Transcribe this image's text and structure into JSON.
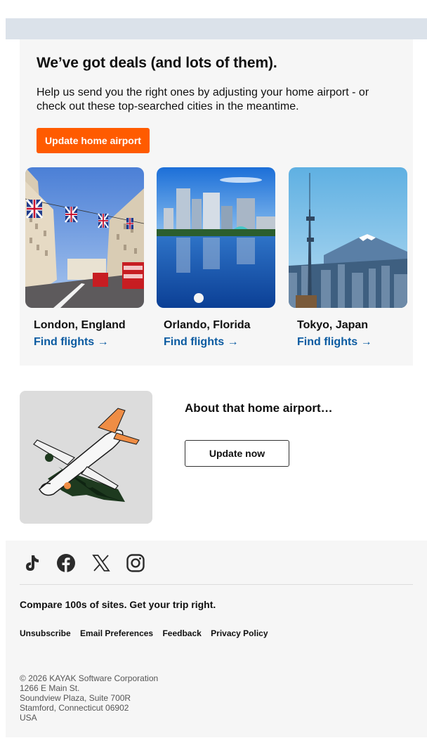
{
  "deals": {
    "title": "We’ve got deals (and lots of them).",
    "subtitle": "Help us send you the right ones by adjusting your home airport - or check out these top-searched cities in the meantime.",
    "button": "Update home airport",
    "cities": [
      {
        "name": "London, England",
        "link": "Find flights →"
      },
      {
        "name": "Orlando, Florida",
        "link": "Find flights →"
      },
      {
        "name": "Tokyo, Japan",
        "link": "Find flights →"
      }
    ]
  },
  "promo": {
    "title": "About that home airport…",
    "button": "Update now"
  },
  "footer": {
    "social_icons": [
      "tiktok-icon",
      "facebook-icon",
      "x-icon",
      "instagram-icon"
    ],
    "tagline": "Compare 100s of sites. Get your trip right.",
    "links": [
      "Unsubscribe",
      "Email Preferences",
      "Feedback",
      "Privacy Policy"
    ],
    "address": [
      "© 2026 KAYAK Software Corporation",
      "1266 E Main St.",
      "Soundview Plaza, Suite 700R",
      "Stamford, Connecticut 06902",
      "USA"
    ]
  },
  "colors": {
    "accent": "#ff5b00",
    "link": "#0b5ba1",
    "top_band": "#dbe2ea",
    "panel": "#f6f6f6"
  }
}
